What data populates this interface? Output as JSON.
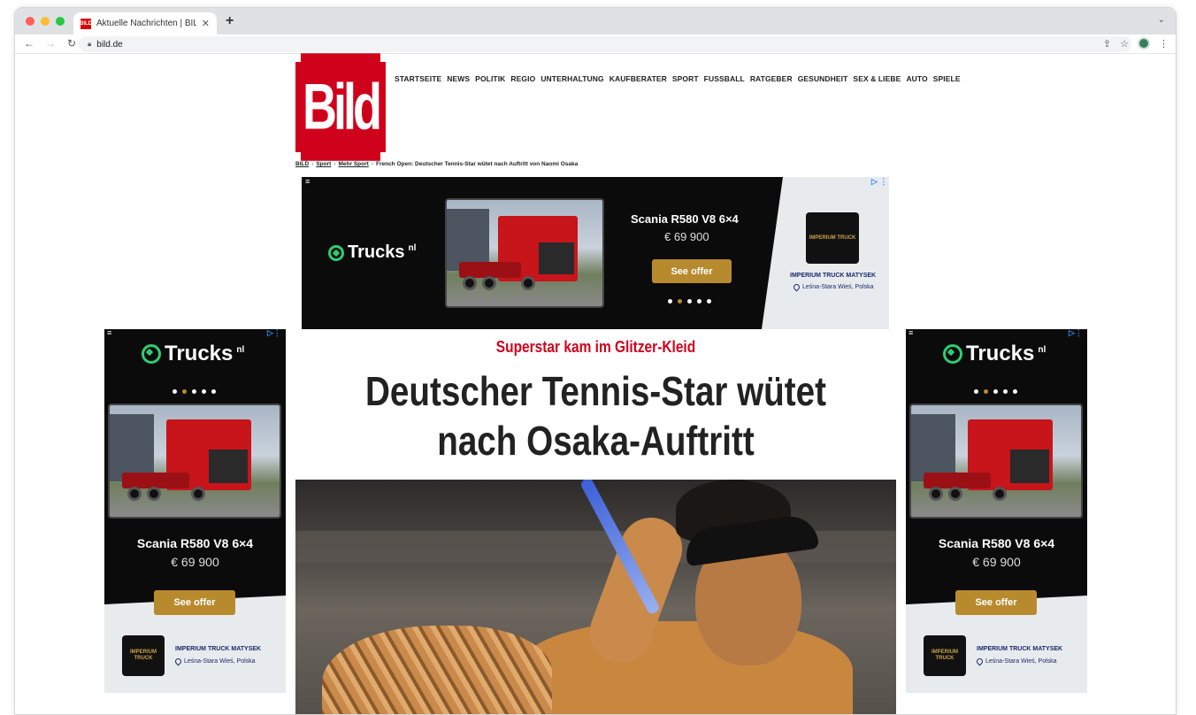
{
  "browser": {
    "tab_title": "Aktuelle Nachrichten | BILD.de",
    "favicon_text": "BILD",
    "url": "bild.de",
    "new_tab_glyph": "+",
    "close_glyph": "✕",
    "tab_menu_glyph": "⌄",
    "traffic_colors": [
      "#ff5f57",
      "#febc2e",
      "#28c840"
    ]
  },
  "site": {
    "logo_text": "Bild",
    "brand_color": "#d0021b",
    "nav": [
      "STARTSEITE",
      "NEWS",
      "POLITIK",
      "REGIO",
      "UNTERHALTUNG",
      "KAUFBERATER",
      "SPORT",
      "FUSSBALL",
      "RATGEBER",
      "GESUNDHEIT",
      "SEX & LIEBE",
      "AUTO",
      "SPIELE"
    ],
    "breadcrumb": {
      "items": [
        "BILD",
        "Sport",
        "Mehr Sport"
      ],
      "current": "French Open: Deutscher Tennis-Star wütet nach Auftritt von Naomi Osaka",
      "sep": "›"
    }
  },
  "ad": {
    "brand": "Trucks",
    "brand_suffix": "nl",
    "title": "Scania R580 V8 6×4",
    "price": "€ 69 900",
    "cta": "See offer",
    "dealer_name": "IMPERIUM TRUCK MATYSEK",
    "dealer_location": "Leśna-Stara Wieś, Polska",
    "dealer_logo_text": "IMPERIUM TRUCK",
    "dots_total": 5,
    "dots_active": 1,
    "accent": "#b88a2e",
    "green": "#2ecc71"
  },
  "article": {
    "kicker": "Superstar kam im Glitzer-Kleid",
    "headline_line1": "Deutscher Tennis-Star wütet",
    "headline_line2": "nach Osaka-Auftritt"
  }
}
